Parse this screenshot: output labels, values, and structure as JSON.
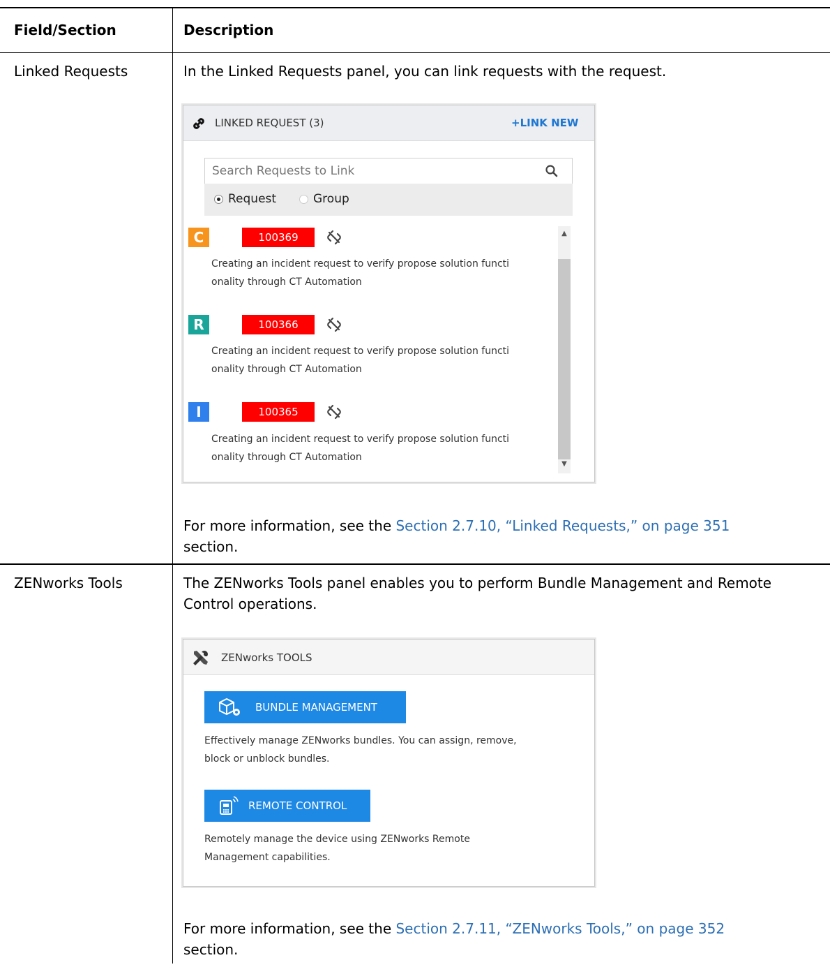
{
  "table": {
    "headers": {
      "field": "Field/Section",
      "description": "Description"
    },
    "rows": [
      {
        "field": "Linked Requests",
        "intro": "In the Linked Requests panel, you can link requests with the request.",
        "more_prefix": "For more information, see the ",
        "more_link": "Section 2.7.10, “Linked Requests,” on page 351",
        "more_suffix": "section."
      },
      {
        "field": "ZENworks Tools",
        "intro": "The ZENworks Tools panel enables you to perform Bundle Management and Remote Control operations.",
        "more_prefix": "For more information, see the ",
        "more_link": "Section 2.7.11, “ZENworks Tools,” on page 352",
        "more_suffix": "section."
      }
    ]
  },
  "linked_widget": {
    "title": "LINKED REQUEST (3)",
    "link_new": "+LINK NEW",
    "search_placeholder": "Search Requests to Link",
    "radio_options": [
      {
        "label": "Request",
        "selected": true
      },
      {
        "label": "Group",
        "selected": false
      }
    ],
    "requests": [
      {
        "type_letter": "C",
        "type_color": "#f7941d",
        "id": "100369",
        "desc_line1": "Creating an incident request to verify propose solution functi",
        "desc_line2": "onality through CT Automation"
      },
      {
        "type_letter": "R",
        "type_color": "#1aa59b",
        "id": "100366",
        "desc_line1": "Creating an incident request to verify propose solution functi",
        "desc_line2": "onality through CT Automation"
      },
      {
        "type_letter": "I",
        "type_color": "#2f80ed",
        "id": "100365",
        "desc_line1": "Creating an incident request to verify propose solution functi",
        "desc_line2": "onality through CT Automation"
      }
    ]
  },
  "zen_widget": {
    "title": "ZENworks TOOLS",
    "bundle_button": "BUNDLE MANAGEMENT",
    "bundle_desc_line1": "Effectively manage ZENworks bundles. You can assign, remove,",
    "bundle_desc_line2": "block or unblock bundles.",
    "remote_button": "REMOTE CONTROL",
    "remote_desc_line1": "Remotely manage the device using ZENworks Remote",
    "remote_desc_line2": "Management capabilities."
  }
}
